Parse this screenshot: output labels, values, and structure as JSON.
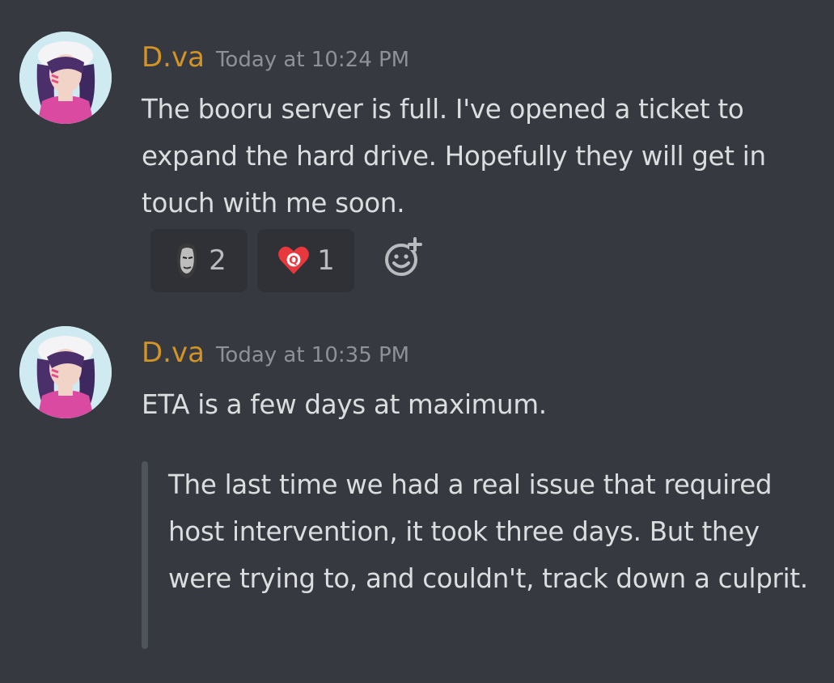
{
  "messages": [
    {
      "username": "D.va",
      "timestamp": "Today at 10:24 PM",
      "text": "The booru server is full. I've opened a ticket to expand the hard drive. Hopefully they will get in touch with me soon.",
      "reactions": [
        {
          "emoji": "gigachad-face-emoji",
          "count": "2"
        },
        {
          "emoji": "red-heart-q-emoji",
          "count": "1"
        }
      ]
    },
    {
      "username": "D.va",
      "timestamp": "Today at 10:35 PM",
      "text": "ETA is a few days at maximum.",
      "quote": "The last time we had a real issue that required host intervention, it took three days. But they were trying to, and couldn't, track down a culprit."
    }
  ],
  "colors": {
    "background": "#36393f",
    "username": "#d39426",
    "timestamp": "#8e9297",
    "text": "#dcddde",
    "reaction_bg": "#2f3136",
    "quote_bar": "#4f545c"
  }
}
